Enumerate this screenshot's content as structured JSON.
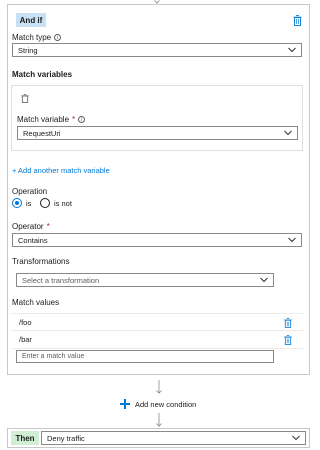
{
  "condition": {
    "badge": "And if",
    "match_type": {
      "label": "Match type",
      "value": "String"
    },
    "match_variables": {
      "heading": "Match variables",
      "variable_label": "Match variable",
      "required_mark": "*",
      "variable_value": "RequestUri"
    },
    "add_variable_link": "+ Add another match variable",
    "operation": {
      "label": "Operation",
      "options": [
        {
          "label": "is",
          "checked": true
        },
        {
          "label": "is not",
          "checked": false
        }
      ]
    },
    "operator": {
      "label": "Operator",
      "required_mark": "*",
      "value": "Contains"
    },
    "transformations": {
      "label": "Transformations",
      "placeholder": "Select a transformation"
    },
    "match_values": {
      "label": "Match values",
      "items": [
        "/foo",
        "/bar"
      ],
      "input_placeholder": "Enter a match value"
    }
  },
  "add_condition": {
    "label": "Add new condition"
  },
  "then": {
    "badge": "Then",
    "value": "Deny traffic"
  },
  "colors": {
    "accent": "#0078d4",
    "and_if_badge": "#c7e0f4",
    "then_badge": "#cfeed4",
    "required": "#a4262c"
  }
}
